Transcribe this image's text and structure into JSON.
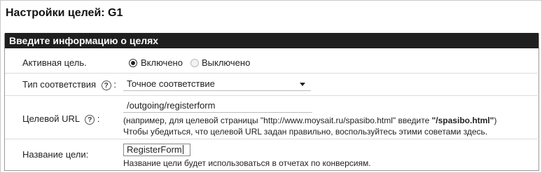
{
  "page": {
    "title": "Настройки целей: G1"
  },
  "section": {
    "header": "Введите информацию о целях"
  },
  "active_goal": {
    "label": "Активная цель.",
    "options": [
      "Включено",
      "Выключено"
    ],
    "selected": "Включено"
  },
  "match_type": {
    "label": "Тип соответствия",
    "help_icon": "?",
    "suffix": ":",
    "selected_value": "Точное соответствие"
  },
  "goal_url": {
    "label": "Целевой URL",
    "help_icon": "?",
    "suffix": ":",
    "value": "/outgoing/registerform",
    "hint_prefix": "(например, для целевой страницы \"http://www.moysait.ru/spasibo.html\" введите ",
    "hint_bold": "\"/spasibo.html\"",
    "hint_suffix": ")",
    "hint2": "Чтобы убедиться, что целевой URL задан правильно, воспользуйтесь этими советами здесь."
  },
  "goal_name": {
    "label": "Название цели:",
    "value": "RegisterForm",
    "hint": "Название цели будет использоваться в отчетах по конверсиям."
  }
}
